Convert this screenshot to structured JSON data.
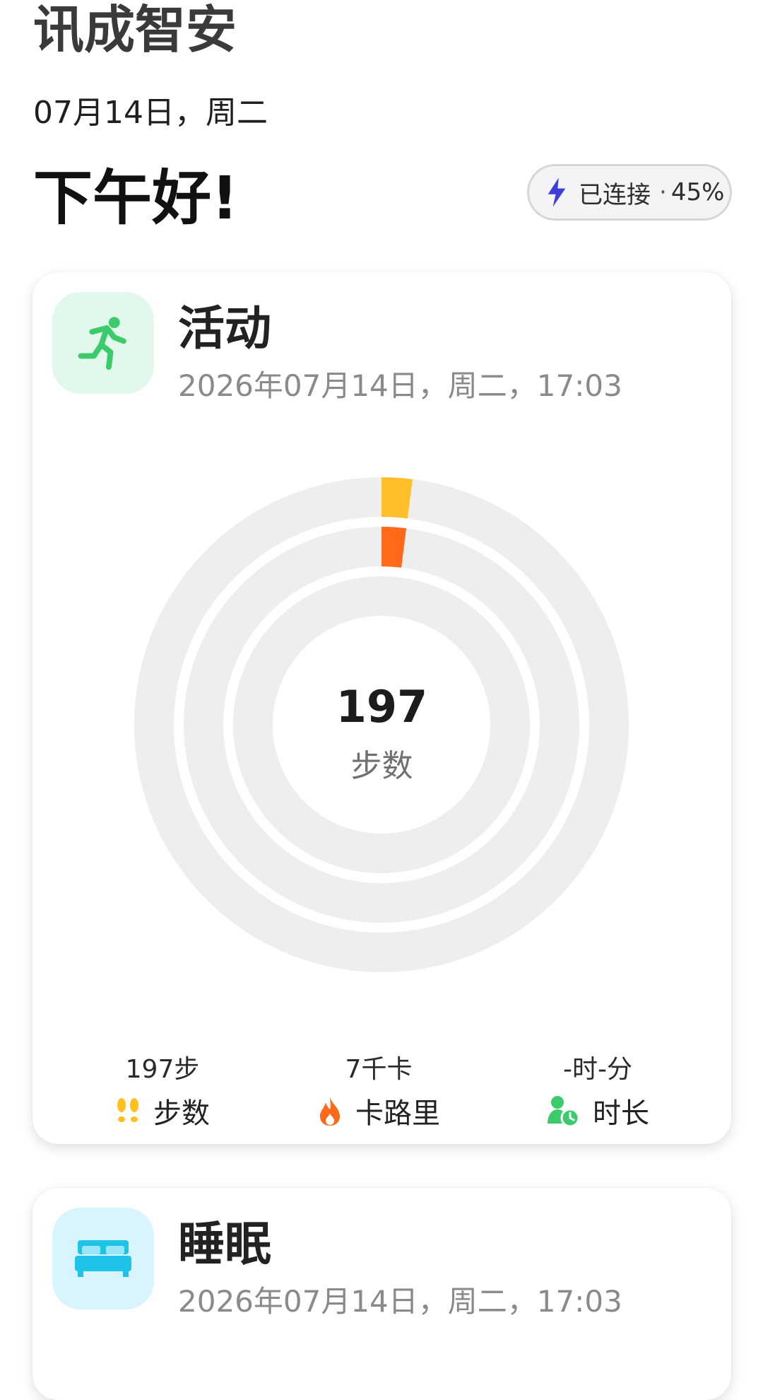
{
  "header": {
    "app_title": "讯成智安",
    "date": "07月14日，周二",
    "greeting": "下午好!",
    "connection": {
      "status": "已连接",
      "separator": "·",
      "battery": "45%"
    }
  },
  "activity": {
    "title": "活动",
    "timestamp": "2026年07月14日，周二，17:03",
    "center_value": "197",
    "center_label": "步数",
    "rings": {
      "outer_progress": 0.02,
      "middle_progress": 0.02,
      "inner_progress": 0,
      "outer_color": "#FFBF2A",
      "middle_color": "#FF6A1A",
      "track_color": "#EEEEEE"
    },
    "stats": [
      {
        "value": "197步",
        "label": "步数",
        "icon": "footsteps-icon",
        "color": "#FFC020"
      },
      {
        "value": "7千卡",
        "label": "卡路里",
        "icon": "flame-icon",
        "color": "#FF6A1A"
      },
      {
        "value": "-时-分",
        "label": "时长",
        "icon": "person-clock-icon",
        "color": "#3CCB6A"
      }
    ]
  },
  "sleep": {
    "title": "睡眠",
    "timestamp": "2026年07月14日，周二，17:03"
  },
  "colors": {
    "activity_icon_bg": "#E3F8EC",
    "activity_icon": "#3CCB6A",
    "sleep_icon_bg": "#D8F5FD",
    "sleep_icon": "#1EC3E8",
    "bolt": "#3D3FD6"
  }
}
